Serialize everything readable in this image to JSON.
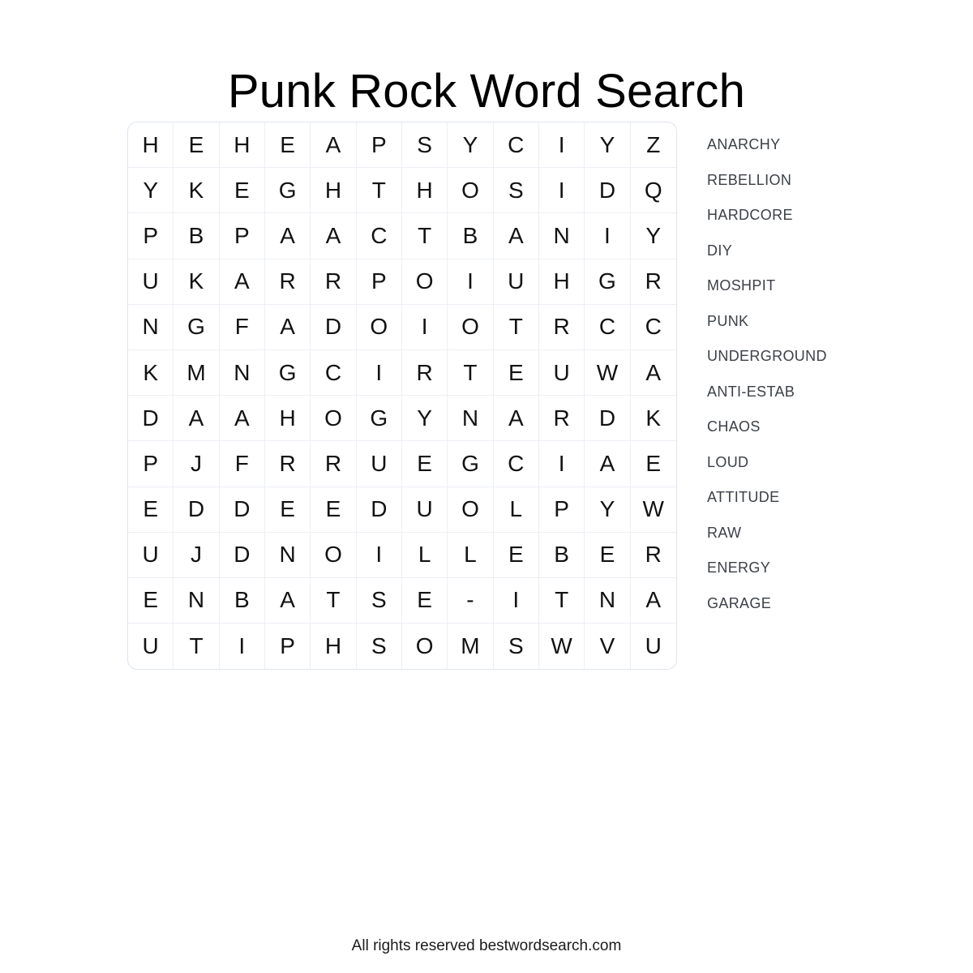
{
  "page": {
    "title": "Punk Rock Word Search",
    "background_color": "#ffffff",
    "footer": "All rights reserved bestwordsearch.com"
  },
  "grid": {
    "rows": 12,
    "columns": 12,
    "border_color": "#dfe4ef",
    "cell_border_color": "#eceff5",
    "letter_color": "#121212",
    "letters": [
      [
        "H",
        "E",
        "H",
        "E",
        "A",
        "P",
        "S",
        "Y",
        "C",
        "I",
        "Y",
        "Z"
      ],
      [
        "Y",
        "K",
        "E",
        "G",
        "H",
        "T",
        "H",
        "O",
        "S",
        "I",
        "D",
        "Q"
      ],
      [
        "P",
        "B",
        "P",
        "A",
        "A",
        "C",
        "T",
        "B",
        "A",
        "N",
        "I",
        "Y"
      ],
      [
        "U",
        "K",
        "A",
        "R",
        "R",
        "P",
        "O",
        "I",
        "U",
        "H",
        "G",
        "R"
      ],
      [
        "N",
        "G",
        "F",
        "A",
        "D",
        "O",
        "I",
        "O",
        "T",
        "R",
        "C",
        "C"
      ],
      [
        "K",
        "M",
        "N",
        "G",
        "C",
        "I",
        "R",
        "T",
        "E",
        "U",
        "W",
        "A"
      ],
      [
        "D",
        "A",
        "A",
        "H",
        "O",
        "G",
        "Y",
        "N",
        "A",
        "R",
        "D",
        "K"
      ],
      [
        "P",
        "J",
        "F",
        "R",
        "R",
        "U",
        "E",
        "G",
        "C",
        "I",
        "A",
        "E"
      ],
      [
        "E",
        "D",
        "D",
        "E",
        "E",
        "D",
        "U",
        "O",
        "L",
        "P",
        "Y",
        "W"
      ],
      [
        "U",
        "J",
        "D",
        "N",
        "O",
        "I",
        "L",
        "L",
        "E",
        "B",
        "E",
        "R"
      ],
      [
        "E",
        "N",
        "B",
        "A",
        "T",
        "S",
        "E",
        "-",
        "I",
        "T",
        "N",
        "A"
      ],
      [
        "U",
        "T",
        "I",
        "P",
        "H",
        "S",
        "O",
        "M",
        "S",
        "W",
        "V",
        "U"
      ]
    ]
  },
  "word_list": {
    "text_color": "#3c4147",
    "words": [
      "ANARCHY",
      "REBELLION",
      "HARDCORE",
      "DIY",
      "MOSHPIT",
      "PUNK",
      "UNDERGROUND",
      "ANTI-ESTAB",
      "CHAOS",
      "LOUD",
      "ATTITUDE",
      "RAW",
      "ENERGY",
      "GARAGE"
    ]
  }
}
